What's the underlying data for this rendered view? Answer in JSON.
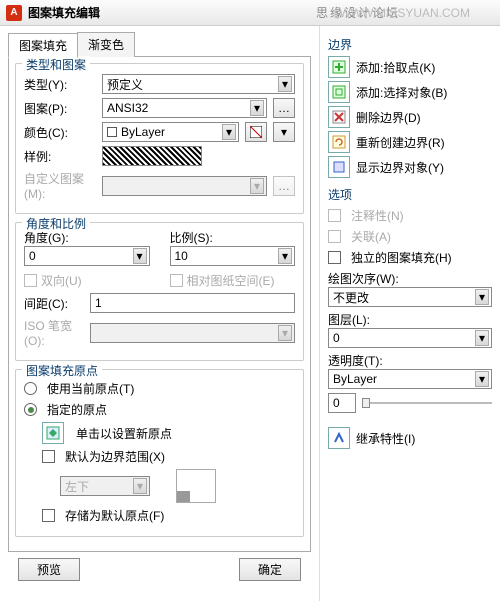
{
  "title": "图案填充编辑",
  "watermark_cn": "思缘设计论坛",
  "watermark_url": "WWW.MISSYUAN.COM",
  "tabs": {
    "hatch": "图案填充",
    "gradient": "渐变色"
  },
  "typePattern": {
    "title": "类型和图案",
    "typeLabel": "类型(Y):",
    "typeValue": "预定义",
    "patternLabel": "图案(P):",
    "patternValue": "ANSI32",
    "colorLabel": "颜色(C):",
    "colorValue": "ByLayer",
    "sampleLabel": "样例:",
    "customLabel": "自定义图案(M):"
  },
  "angleScale": {
    "title": "角度和比例",
    "angleLabel": "角度(G):",
    "angleValue": "0",
    "scaleLabel": "比例(S):",
    "scaleValue": "10",
    "double": "双向(U)",
    "relative": "相对图纸空间(E)",
    "spacingLabel": "间距(C):",
    "spacingValue": "1",
    "isoPenLabel": "ISO 笔宽(O):"
  },
  "origin": {
    "title": "图案填充原点",
    "useCurrent": "使用当前原点(T)",
    "specified": "指定的原点",
    "clickSet": "单击以设置新原点",
    "defaultBoundary": "默认为边界范围(X)",
    "position": "左下",
    "storeDefault": "存储为默认原点(F)"
  },
  "boundaries": {
    "title": "边界",
    "addPick": "添加:拾取点(K)",
    "addSelect": "添加:选择对象(B)",
    "remove": "删除边界(D)",
    "recreate": "重新创建边界(R)",
    "display": "显示边界对象(Y)"
  },
  "options": {
    "title": "选项",
    "annotative": "注释性(N)",
    "associative": "关联(A)",
    "independent": "独立的图案填充(H)",
    "drawOrderLabel": "绘图次序(W):",
    "drawOrderValue": "不更改",
    "layerLabel": "图层(L):",
    "layerValue": "0",
    "transparencyLabel": "透明度(T):",
    "transparencyValue": "ByLayer",
    "transparencySlider": "0"
  },
  "inherit": "继承特性(I)",
  "footer": {
    "preview": "预览",
    "ok": "确定"
  }
}
